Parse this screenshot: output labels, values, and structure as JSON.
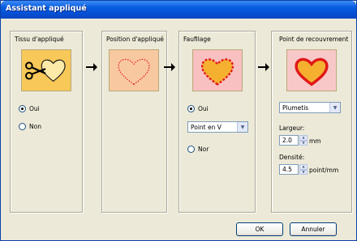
{
  "window": {
    "title": "Assistant appliqué"
  },
  "panels": {
    "fabric": {
      "title": "Tissu d'appliqué",
      "options": {
        "yes": "Oui",
        "no": "Non"
      },
      "selected": "yes"
    },
    "position": {
      "title": "Position d'appliqué"
    },
    "basting": {
      "title": "Faufilage",
      "options": {
        "yes": "Oui",
        "no": "Nor"
      },
      "selected": "yes",
      "stitch_select": {
        "value": "Point en V"
      }
    },
    "covering": {
      "title": "Point de recouvrement",
      "stitch_select": {
        "value": "Plumetis"
      },
      "width": {
        "label": "Largeur:",
        "value": "2.0",
        "unit": "mm"
      },
      "density": {
        "label": "Densité:",
        "value": "4.5",
        "unit": "point/mm"
      }
    }
  },
  "footer": {
    "ok_label": "OK",
    "cancel_label": "Annuler"
  },
  "colors": {
    "title_bar": "#0550d6",
    "art_fabric_bg": "#f8c858",
    "art_position_bg": "#f8c8a0",
    "art_basting_bg": "#f8c0c0",
    "art_cover_bg": "#f8c8c8",
    "heart_red": "#e01818",
    "heart_orange": "#f5b030"
  },
  "icons": {
    "fabric_art": "scissors-cutting-heart-icon",
    "position_art": "dotted-heart-outline-icon",
    "basting_art": "basted-heart-icon",
    "cover_art": "satin-stitched-heart-icon",
    "arrow": "arrow-right-icon"
  }
}
